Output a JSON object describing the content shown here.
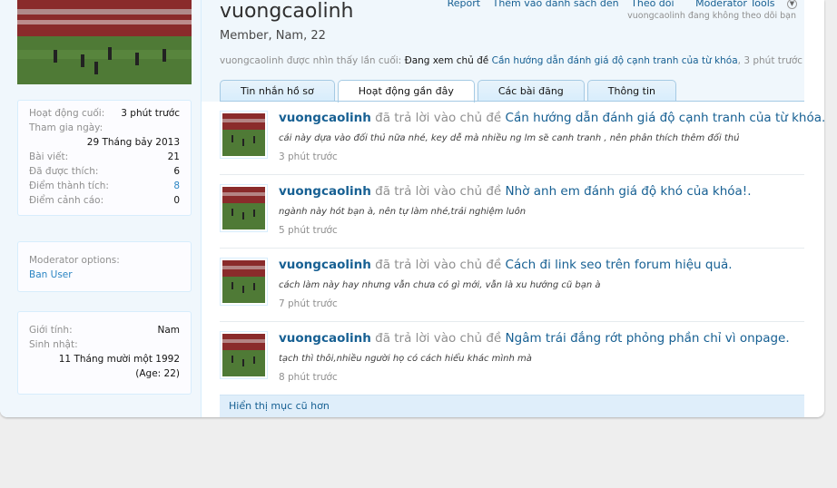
{
  "profile": {
    "username": "vuongcaolinh",
    "user_title": "Member, Nam, 22",
    "last_seen_prefix": "vuongcaolinh được nhìn thấy lần cuối:",
    "last_seen_activity": "Đang xem chủ đề",
    "last_seen_thread": "Cần hướng dẫn đánh giá độ cạnh tranh của từ khóa",
    "last_seen_time": ", 3 phút trước",
    "following_note": "vuongcaolinh đang không theo dõi bạn"
  },
  "top_links": {
    "report": "Report",
    "ignore": "Thêm vào danh sách đen",
    "follow": "Theo dõi",
    "moderator_tools": "Moderator Tools"
  },
  "sidebar": {
    "stats": [
      {
        "label": "Hoạt động cuối:",
        "value": "3 phút trước"
      },
      {
        "label": "Tham gia ngày:",
        "value": "29 Tháng bảy 2013"
      },
      {
        "label": "Bài viết:",
        "value": "21"
      },
      {
        "label": "Đã được thích:",
        "value": "6"
      },
      {
        "label": "Điểm thành tích:",
        "value": "8"
      },
      {
        "label": "Điểm cảnh cáo:",
        "value": "0"
      }
    ],
    "moderator_label": "Moderator options:",
    "ban_user": "Ban User",
    "gender_label": "Giới tính:",
    "gender_value": "Nam",
    "birthday_label": "Sinh nhật:",
    "birthday_value": "11 Tháng mười một 1992",
    "age_value": "(Age: 22)"
  },
  "tabs": [
    {
      "label": "Tin nhắn hồ sơ"
    },
    {
      "label": "Hoạt động gần đây"
    },
    {
      "label": "Các bài đăng"
    },
    {
      "label": "Thông tin"
    }
  ],
  "activity": [
    {
      "user": "vuongcaolinh",
      "action": "đã trả lời vào chủ đề",
      "thread": "Cần hướng dẫn đánh giá độ cạnh tranh của từ khóa.",
      "snippet": "cái này dựa vào đối thủ nữa nhé, key dễ mà nhiều ng lm sẽ canh tranh , nên phân thích thêm đối thủ",
      "time": "3 phút trước"
    },
    {
      "user": "vuongcaolinh",
      "action": "đã trả lời vào chủ đề",
      "thread": "Nhờ anh em đánh giá độ khó của khóa!.",
      "snippet": "ngành này hót bạn à, nên tự làm nhé,trải nghiệm luôn",
      "time": "5 phút trước"
    },
    {
      "user": "vuongcaolinh",
      "action": "đã trả lời vào chủ đề",
      "thread": "Cách đi link seo trên forum hiệu quả.",
      "snippet": "cách làm này hay nhưng vẫn chưa có gì mới, vẫn là xu hướng cũ bạn à",
      "time": "7 phút trước"
    },
    {
      "user": "vuongcaolinh",
      "action": "đã trả lời vào chủ đề",
      "thread": "Ngâm trái đắng rớt phỏng phần chỉ vì onpage.",
      "snippet": "tạch thì thôi,nhiều người họ có cách hiểu khác mình mà",
      "time": "8 phút trước"
    }
  ],
  "more_link": "Hiển thị mục cũ hơn"
}
